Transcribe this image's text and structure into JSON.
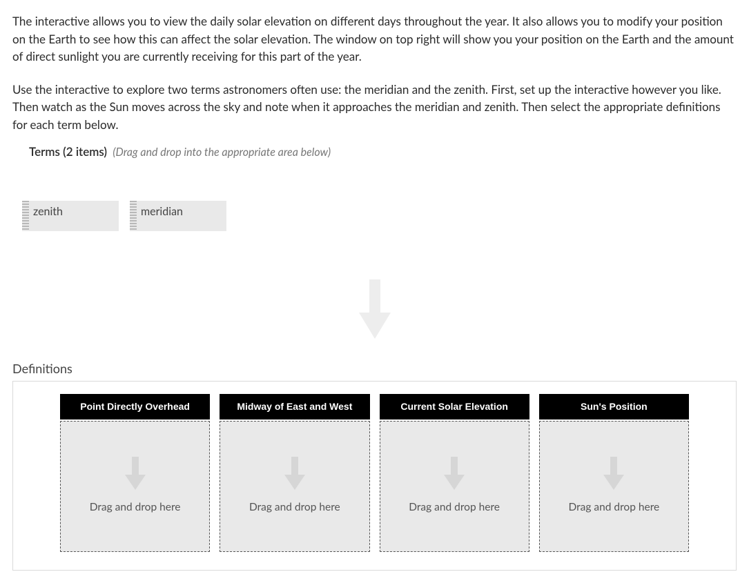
{
  "intro": {
    "p1": "The interactive allows you to view the daily solar elevation on different days throughout the year. It also allows you to modify your position on the Earth to see how this can affect the solar elevation. The window on top right will show you your position on the Earth and the amount of direct sunlight you are currently receiving for this part of the year.",
    "p2": "Use the interactive to explore two terms astronomers often use: the meridian and the zenith. First, set up the interactive however you like. Then watch as the Sun moves across the sky and note when it approaches the meridian and zenith. Then select the appropriate definitions for each term below."
  },
  "terms": {
    "header_title": "Terms (2 items)",
    "header_hint": "(Drag and drop into the appropriate area below)",
    "items": [
      {
        "label": "zenith"
      },
      {
        "label": "meridian"
      }
    ]
  },
  "definitions": {
    "title": "Definitions",
    "columns": [
      {
        "header": "Point Directly Overhead",
        "placeholder": "Drag and drop here"
      },
      {
        "header": "Midway of East and West",
        "placeholder": "Drag and drop here"
      },
      {
        "header": "Current Solar Elevation",
        "placeholder": "Drag and drop here"
      },
      {
        "header": "Sun's Position",
        "placeholder": "Drag and drop here"
      }
    ]
  }
}
